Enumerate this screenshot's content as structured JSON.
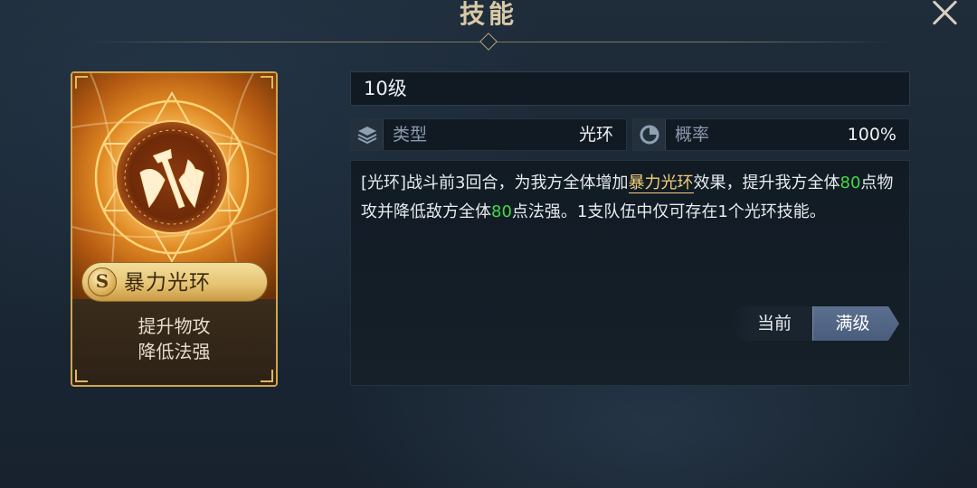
{
  "header": {
    "title": "技能"
  },
  "card": {
    "grade": "S",
    "name": "暴力光环",
    "desc_line1": "提升物攻",
    "desc_line2": "降低法强"
  },
  "detail": {
    "level": "10级",
    "stats": [
      {
        "icon": "layers-icon",
        "label": "类型",
        "value": "光环"
      },
      {
        "icon": "pie-chart-icon",
        "label": "概率",
        "value": "100%"
      }
    ],
    "description": {
      "part1": "[光环]战斗前3回合，为我方全体增加",
      "highlight_name": "暴力光环",
      "part2": "效果，提升我方全体",
      "num1": "80",
      "part3": "点物攻并降低敌方全体",
      "num2": "80",
      "part4": "点法强。1支队伍中仅可存在1个光环技能。"
    },
    "toggle": {
      "current": "当前",
      "max": "满级",
      "selected": "max"
    }
  },
  "colors": {
    "accent_gold": "#f2cf7a",
    "number_green": "#45d64a",
    "toggle_active": "#4a5d7c"
  }
}
